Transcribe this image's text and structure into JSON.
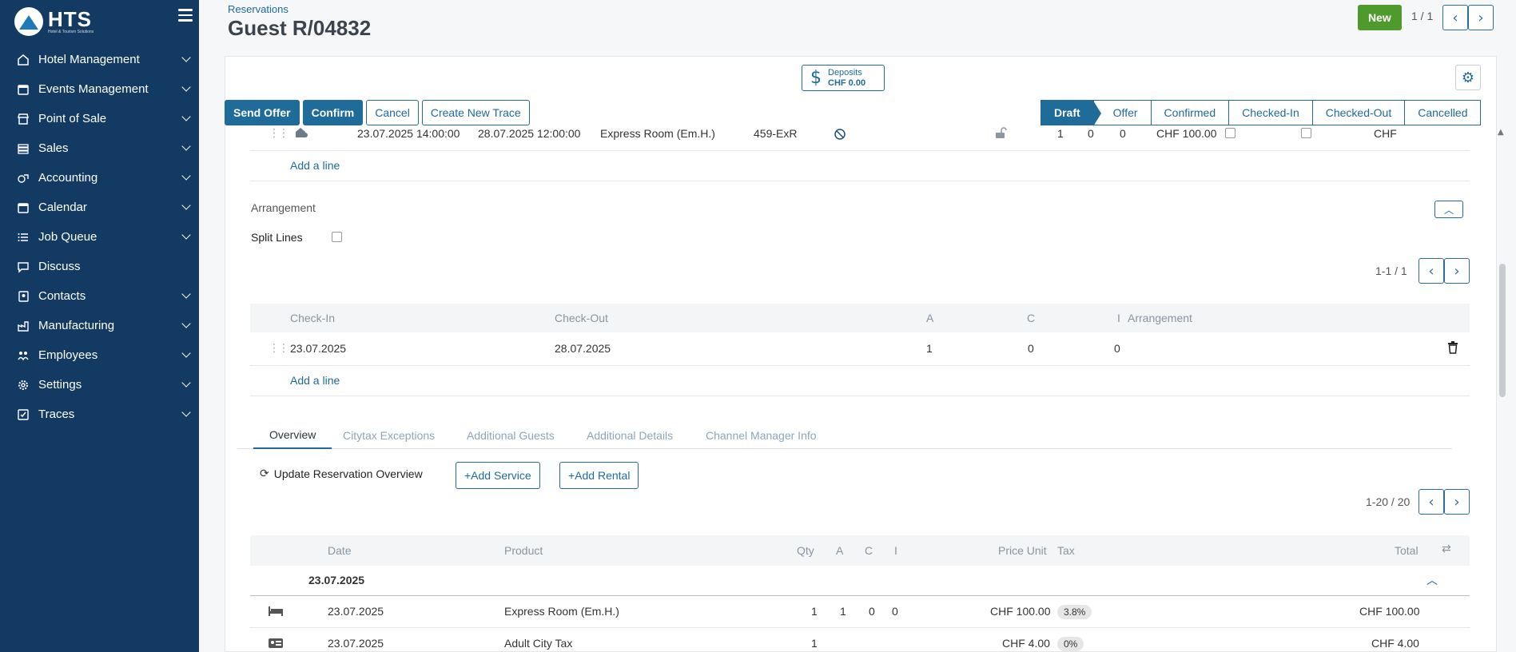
{
  "sidebar": {
    "logo": "HTS",
    "logo_sub": "Hotel & Tourism Solutions",
    "items": [
      {
        "label": "Hotel Management",
        "icon": "home-icon"
      },
      {
        "label": "Events Management",
        "icon": "calendar-icon"
      },
      {
        "label": "Point of Sale",
        "icon": "store-icon"
      },
      {
        "label": "Sales",
        "icon": "stack-icon"
      },
      {
        "label": "Accounting",
        "icon": "accounting-icon"
      },
      {
        "label": "Calendar",
        "icon": "calendar-icon"
      },
      {
        "label": "Job Queue",
        "icon": "list-icon"
      },
      {
        "label": "Discuss",
        "icon": "chat-icon"
      },
      {
        "label": "Contacts",
        "icon": "contacts-icon"
      },
      {
        "label": "Manufacturing",
        "icon": "factory-icon"
      },
      {
        "label": "Employees",
        "icon": "employees-icon"
      },
      {
        "label": "Settings",
        "icon": "gear-icon"
      },
      {
        "label": "Traces",
        "icon": "checkbox-icon"
      }
    ]
  },
  "header": {
    "breadcrumb": "Reservations",
    "title": "Guest R/04832",
    "new_label": "New",
    "pager": "1 / 1"
  },
  "deposits": {
    "label": "Deposits",
    "value": "CHF 0.00"
  },
  "actions": [
    "Send Offer",
    "Confirm",
    "Cancel",
    "Create New Trace"
  ],
  "stages": [
    "Draft",
    "Offer",
    "Confirmed",
    "Checked-In",
    "Checked-Out",
    "Cancelled"
  ],
  "room_line": {
    "checkin": "23.07.2025 14:00:00",
    "checkout": "28.07.2025 12:00:00",
    "room_type": "Express Room (Em.H.)",
    "room": "459-ExR",
    "a": "1",
    "c": "0",
    "i": "0",
    "price": "CHF 100.00",
    "currency": "CHF"
  },
  "add_line": "Add a line",
  "arrangement": {
    "title": "Arrangement",
    "split_lines": "Split Lines",
    "pager": "1-1 / 1",
    "headers": [
      "Check-In",
      "Check-Out",
      "A",
      "C",
      "I",
      "Arrangement"
    ],
    "row": {
      "checkin": "23.07.2025",
      "checkout": "28.07.2025",
      "a": "1",
      "c": "0",
      "i": "0"
    }
  },
  "tabs": [
    "Overview",
    "Citytax Exceptions",
    "Additional Guests",
    "Additional Details",
    "Channel Manager Info"
  ],
  "overview": {
    "update_label": "Update Reservation Overview",
    "add_service": "+Add Service",
    "add_rental": "+Add Rental",
    "pager": "1-20 / 20",
    "headers": [
      "Date",
      "Product",
      "Qty",
      "A",
      "C",
      "I",
      "Price Unit",
      "Tax",
      "Total"
    ],
    "group": "23.07.2025",
    "rows": [
      {
        "date": "23.07.2025",
        "product": "Express Room (Em.H.)",
        "qty": "1",
        "a": "1",
        "c": "0",
        "i": "0",
        "price": "CHF 100.00",
        "tax": "3.8%",
        "total": "CHF 100.00",
        "icon": "bed-icon"
      },
      {
        "date": "23.07.2025",
        "product": "Adult City Tax",
        "qty": "1",
        "a": "",
        "c": "",
        "i": "",
        "price": "CHF 4.00",
        "tax": "0%",
        "total": "CHF 4.00",
        "icon": "id-card-icon"
      }
    ]
  },
  "colors": {
    "sidebar": "#123a62",
    "primary": "#1f6b9a",
    "new_button": "#4e9a2c"
  }
}
